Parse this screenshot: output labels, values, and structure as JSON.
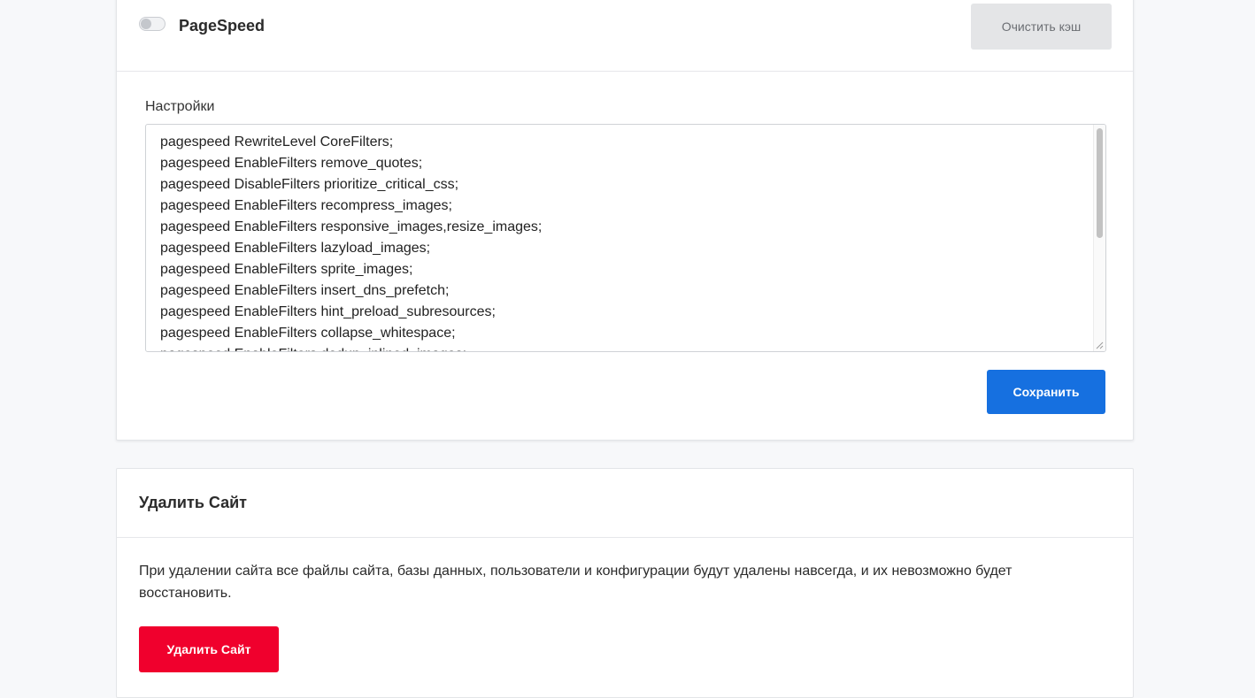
{
  "pagespeed": {
    "title": "PageSpeed",
    "toggle_enabled": false,
    "clear_cache_label": "Очистить кэш",
    "settings_label": "Настройки",
    "settings_lines": [
      "pagespeed RewriteLevel CoreFilters;",
      "pagespeed EnableFilters remove_quotes;",
      "pagespeed DisableFilters prioritize_critical_css;",
      "pagespeed EnableFilters recompress_images;",
      "pagespeed EnableFilters responsive_images,resize_images;",
      "pagespeed EnableFilters lazyload_images;",
      "pagespeed EnableFilters sprite_images;",
      "pagespeed EnableFilters insert_dns_prefetch;",
      "pagespeed EnableFilters hint_preload_subresources;",
      "pagespeed EnableFilters collapse_whitespace;",
      "pagespeed EnableFilters dedup_inlined_images;"
    ],
    "save_label": "Сохранить"
  },
  "delete_site": {
    "title": "Удалить Сайт",
    "description": "При удалении сайта все файлы сайта, базы данных, пользователи и конфигурации будут удалены навсегда, и их невозможно будет восстановить.",
    "button_label": "Удалить Сайт"
  },
  "colors": {
    "primary": "#1670e0",
    "danger": "#f0002d",
    "disabled_button": "#e4e5e7"
  }
}
